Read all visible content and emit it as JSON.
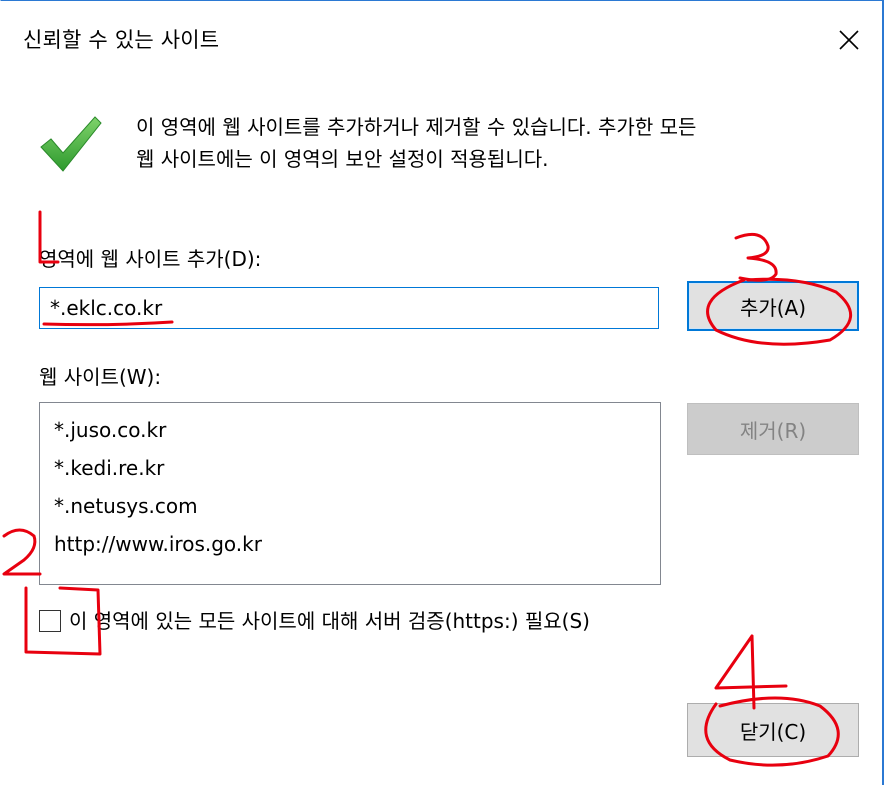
{
  "dialog": {
    "title": "신뢰할 수 있는 사이트",
    "close_icon": "close-icon",
    "check_icon": "checkmark-icon",
    "description_line1": "이 영역에 웹 사이트를 추가하거나 제거할 수 있습니다. 추가한 모든",
    "description_line2": "웹 사이트에는 이 영역의 보안 설정이 적용됩니다.",
    "add_site_label": "영역에 웹 사이트 추가(D):",
    "add_site_value": "*.eklc.co.kr",
    "add_button_label": "추가(A)",
    "websites_label": "웹 사이트(W):",
    "websites": [
      "*.juso.co.kr",
      "*.kedi.re.kr",
      "*.netusys.com",
      "http://www.iros.go.kr"
    ],
    "remove_button_label": "제거(R)",
    "require_https_label": "이 영역에 있는 모든 사이트에 대해 서버 검증(https:) 필요(S)",
    "require_https_checked": false,
    "close_button_label": "닫기(C)"
  },
  "annotations": {
    "marks": [
      "1",
      "2",
      "3",
      "4"
    ],
    "color": "#e8000f"
  },
  "colors": {
    "accent": "#0078d7",
    "button_bg": "#e1e1e1",
    "disabled_text": "#838383",
    "check_green": "#3aa83a"
  }
}
